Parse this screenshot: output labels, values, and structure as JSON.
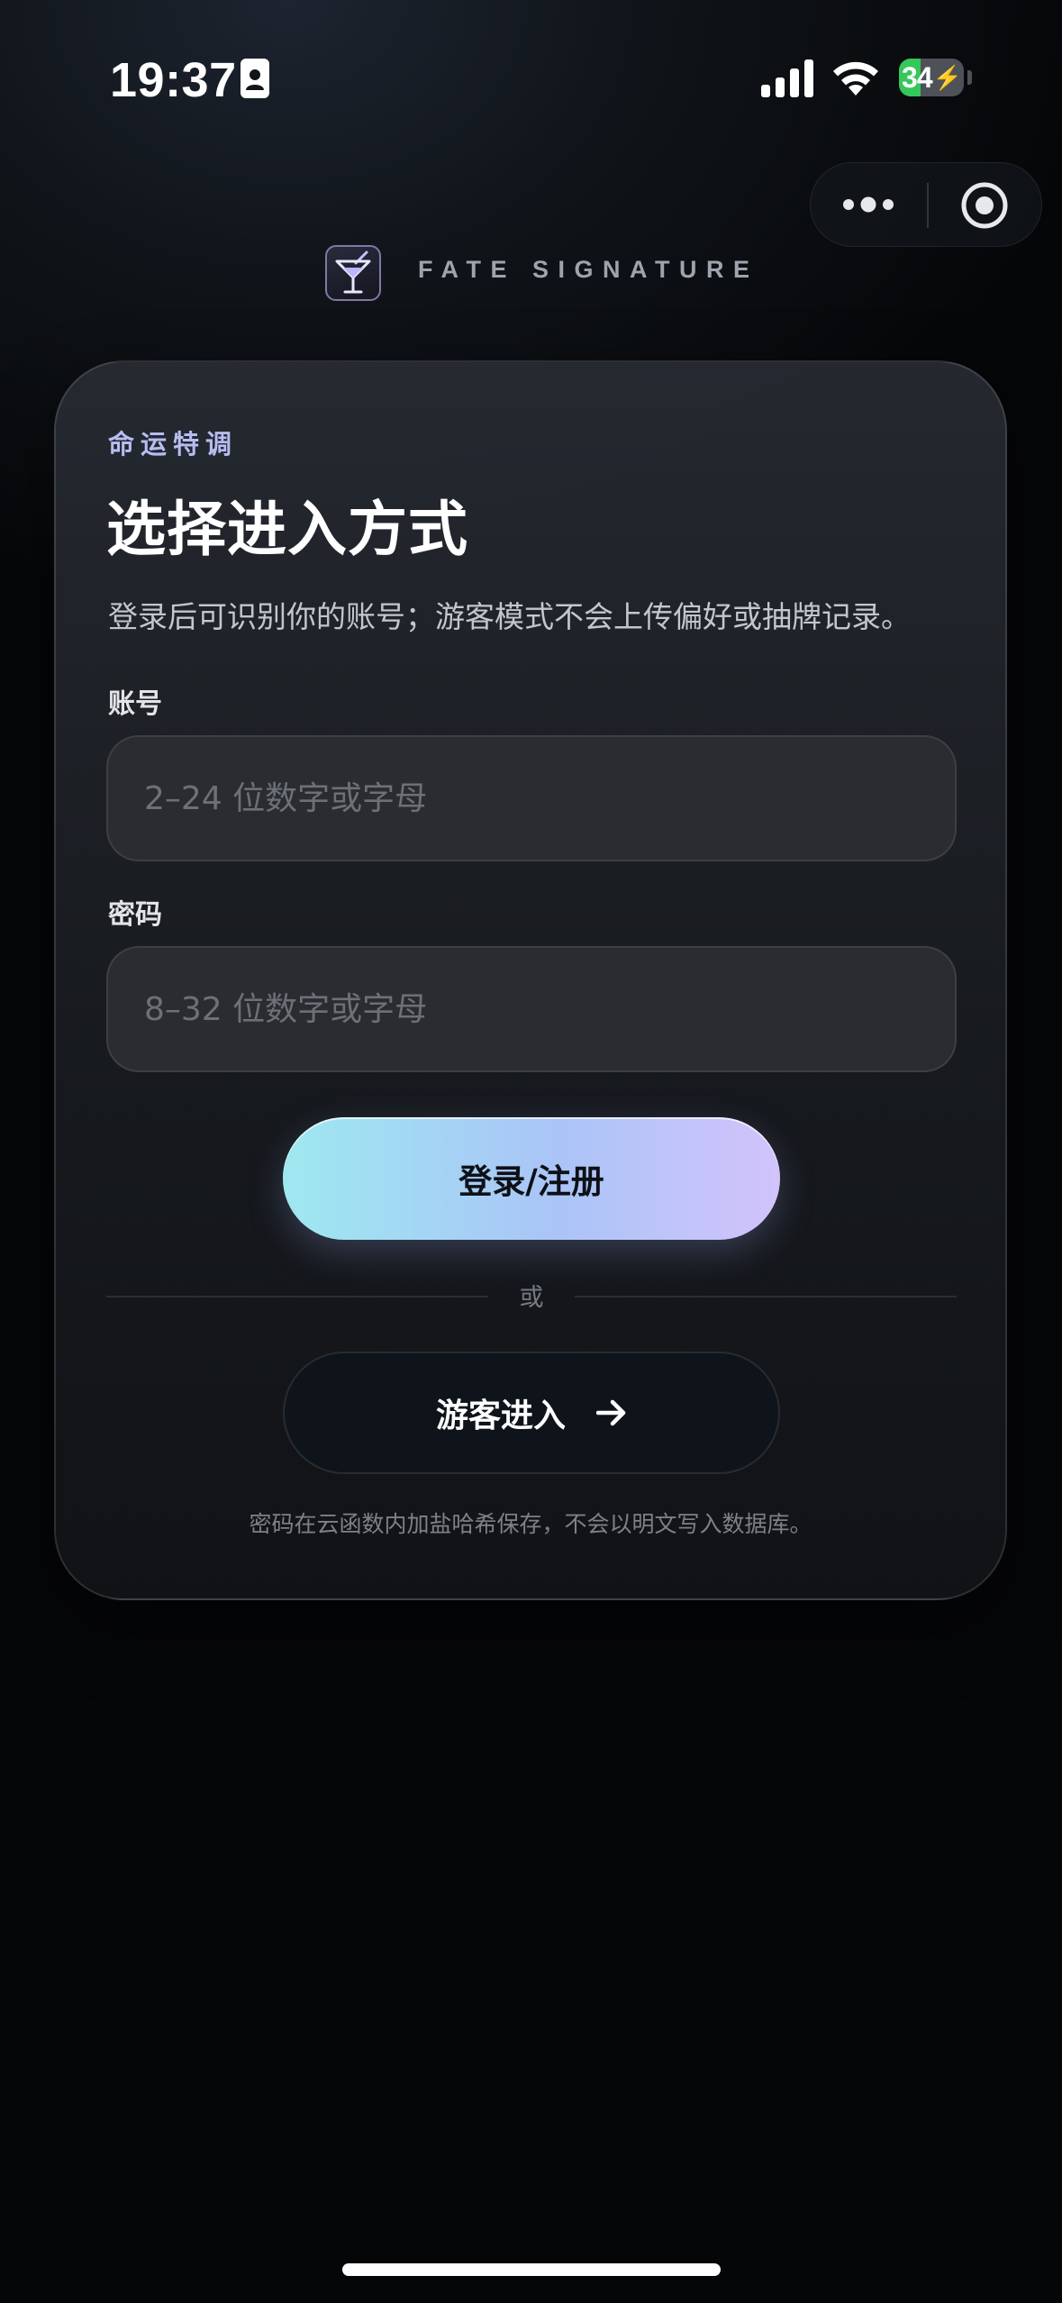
{
  "status_bar": {
    "time": "19:37",
    "battery_level": "34",
    "battery_fraction": 0.34
  },
  "brand": {
    "name": "FATE SIGNATURE",
    "logo_icon": "cocktail-glass-icon"
  },
  "card": {
    "eyebrow": "命运特调",
    "title": "选择进入方式",
    "description": "登录后可识别你的账号；游客模式不会上传偏好或抽牌记录。",
    "account": {
      "label": "账号",
      "placeholder": "2–24 位数字或字母",
      "value": ""
    },
    "password": {
      "label": "密码",
      "placeholder": "8–32 位数字或字母",
      "value": ""
    },
    "login_button": "登录/注册",
    "divider_text": "或",
    "guest_button": "游客进入",
    "footnote": "密码在云函数内加盐哈希保存，不会以明文写入数据库。"
  },
  "colors": {
    "accent_gradient_start": "#9ee8f0",
    "accent_gradient_end": "#d2c3fb",
    "eyebrow": "#b7bcf2",
    "battery_green": "#35c759"
  }
}
